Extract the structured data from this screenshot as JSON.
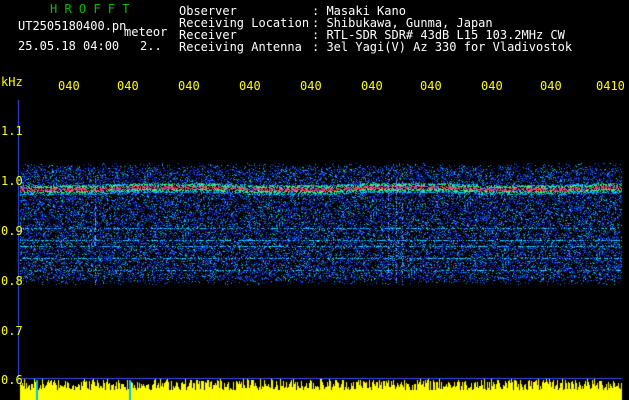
{
  "header": {
    "app_title": "H R O F F T",
    "file_name": "UT2505180400.pn",
    "file_suffix": "meteor",
    "datetime": "25.05.18 04:00",
    "count": "2..",
    "labels": {
      "observer": "Observer",
      "location": "Receiving Location",
      "receiver": "Receiver",
      "antenna": "Receiving Antenna"
    },
    "values": {
      "observer": ": Masaki Kano",
      "location": ": Shibukawa, Gunma, Japan",
      "receiver": ": RTL-SDR SDR# 43dB L15 103.2MHz CW",
      "antenna": ": 3el Yagi(V) Az 330 for Vladivostok"
    }
  },
  "plot": {
    "y_unit": "kHz",
    "y_ticks": [
      "1.1",
      "1.0",
      "0.9",
      "0.8",
      "0.7",
      "0.6"
    ],
    "x_ticks": [
      "040",
      "040",
      "040",
      "040",
      "040",
      "040",
      "040",
      "040",
      "040",
      "0410"
    ],
    "colors": {
      "text": "#ffff00",
      "header_title": "#00c000",
      "background": "#000000",
      "strong_echo": "#ff2020",
      "trace": "#00ff80",
      "noise": "#1a3cff"
    }
  }
}
